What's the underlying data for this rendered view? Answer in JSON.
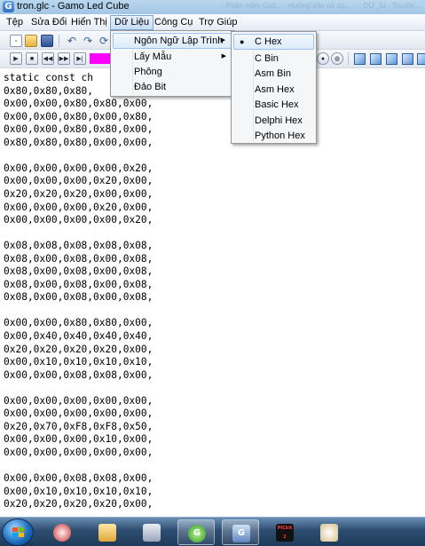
{
  "window": {
    "title": "tron.glc - Gamo Led Cube",
    "app_icon_glyph": "G",
    "background_titles": [
      "· Phần mềm Gco...",
      "· Hướng dẫn sử dụ...",
      "· DỮ_IU - Truyền..."
    ]
  },
  "menubar": {
    "items": [
      {
        "id": "file",
        "label": "Tệp"
      },
      {
        "id": "edit",
        "label": "Sửa Đổi"
      },
      {
        "id": "view",
        "label": "Hiển Thị"
      },
      {
        "id": "data",
        "label": "Dữ Liệu"
      },
      {
        "id": "tools",
        "label": "Công Cụ"
      },
      {
        "id": "help",
        "label": "Trợ Giúp"
      }
    ]
  },
  "toolbar": {
    "buttons": [
      "new-file-icon",
      "open-folder-icon",
      "save-icon",
      "undo-icon",
      "redo-icon"
    ],
    "playback": [
      "play-icon",
      "stop-icon",
      "rewind-icon",
      "fast-forward-icon",
      "step-forward-icon"
    ],
    "color_swatch": "#ff00ff",
    "view_cubes": [
      "cube-front-icon",
      "cube-back-icon",
      "cube-left-icon",
      "cube-right-icon",
      "cube-top-icon",
      "cube-bottom-icon"
    ]
  },
  "data_menu": {
    "items": [
      {
        "id": "language",
        "label": "Ngôn Ngữ Lập Trình",
        "submenu": true,
        "highlighted": true
      },
      {
        "id": "sample",
        "label": "Lấy Mẫu",
        "submenu": true,
        "highlighted": false
      },
      {
        "id": "font",
        "label": "Phông",
        "submenu": false,
        "highlighted": false
      },
      {
        "id": "invert",
        "label": "Đảo Bit",
        "submenu": false,
        "highlighted": false
      }
    ],
    "language_submenu": {
      "selected": "C Hex",
      "items": [
        "C Hex",
        "C Bin",
        "Asm Bin",
        "Asm Hex",
        "Basic Hex",
        "Delphi Hex",
        "Python Hex"
      ]
    }
  },
  "code": {
    "lines": [
      "static const ch",
      "0x80,0x80,0x80,",
      "0x00,0x00,0x80,0x80,0x00,",
      "0x00,0x00,0x80,0x00,0x80,",
      "0x00,0x00,0x80,0x80,0x00,",
      "0x80,0x80,0x80,0x00,0x00,",
      "",
      "0x00,0x00,0x00,0x00,0x20,",
      "0x00,0x00,0x00,0x20,0x00,",
      "0x20,0x20,0x20,0x00,0x00,",
      "0x00,0x00,0x00,0x20,0x00,",
      "0x00,0x00,0x00,0x00,0x20,",
      "",
      "0x08,0x08,0x08,0x08,0x08,",
      "0x08,0x00,0x08,0x00,0x08,",
      "0x08,0x00,0x08,0x00,0x08,",
      "0x08,0x00,0x08,0x00,0x08,",
      "0x08,0x00,0x08,0x00,0x08,",
      "",
      "0x00,0x00,0x80,0x80,0x00,",
      "0x00,0x40,0x40,0x40,0x40,",
      "0x20,0x20,0x20,0x20,0x00,",
      "0x00,0x10,0x10,0x10,0x10,",
      "0x00,0x00,0x08,0x08,0x00,",
      "",
      "0x00,0x00,0x00,0x00,0x00,",
      "0x00,0x00,0x00,0x00,0x00,",
      "0x20,0x70,0xF8,0xF8,0x50,",
      "0x00,0x00,0x00,0x10,0x00,",
      "0x00,0x00,0x00,0x00,0x00,",
      "",
      "0x00,0x00,0x08,0x08,0x00,",
      "0x00,0x10,0x10,0x10,0x10,",
      "0x20,0x20,0x20,0x20,0x00,"
    ]
  },
  "taskbar": {
    "tasks": [
      {
        "name": "start-button"
      },
      {
        "name": "network-tool-icon",
        "active": false
      },
      {
        "name": "file-explorer-icon",
        "active": false
      },
      {
        "name": "calculator-icon",
        "active": false
      },
      {
        "name": "gamo-app-icon",
        "active": true
      },
      {
        "name": "glc-editor-icon",
        "active": true
      },
      {
        "name": "pickit2-icon",
        "glyph": "PICkit 2",
        "active": false
      },
      {
        "name": "paint-icon",
        "active": false
      }
    ]
  }
}
